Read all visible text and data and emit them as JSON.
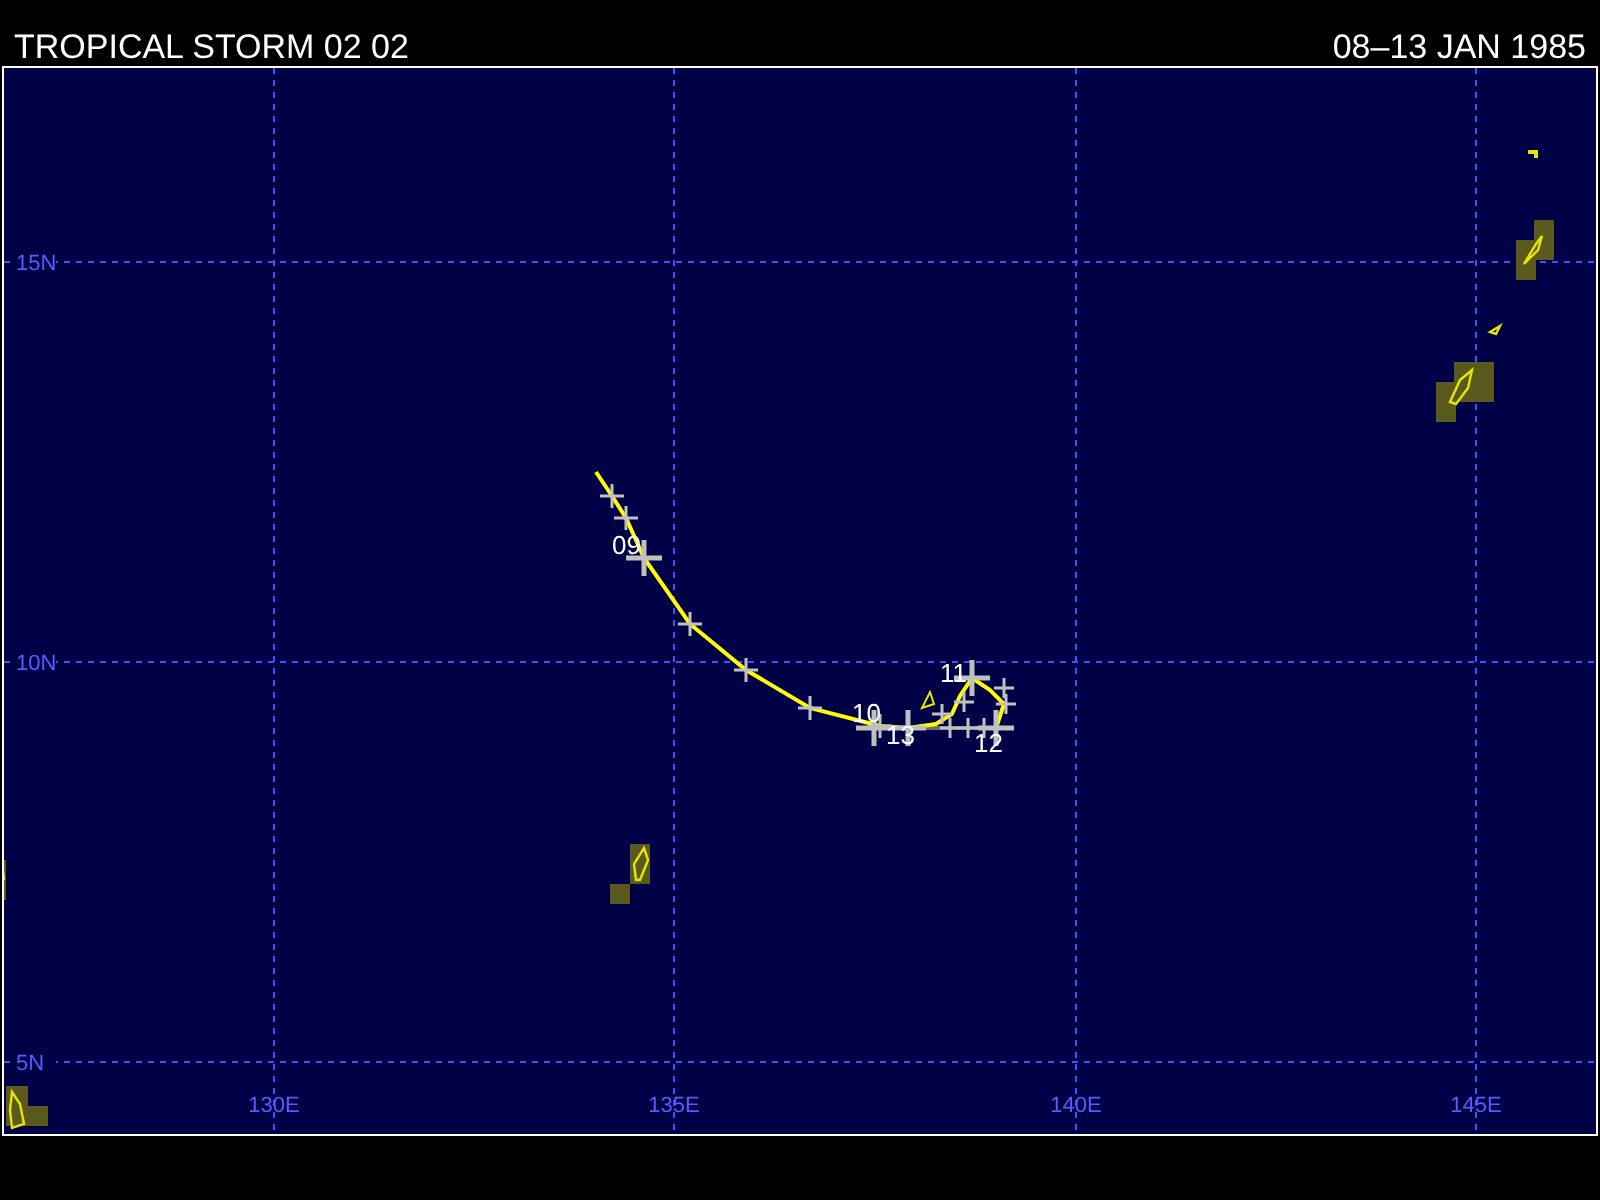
{
  "header": {
    "title": "TROPICAL STORM 02 02",
    "dates": "08–13 JAN 1985"
  },
  "map": {
    "lat_labels": [
      "15N",
      "10N",
      "5N"
    ],
    "lon_labels": [
      "130E",
      "135E",
      "140E",
      "145E"
    ],
    "track_days": [
      "09",
      "10",
      "11",
      "12",
      "13"
    ]
  }
}
